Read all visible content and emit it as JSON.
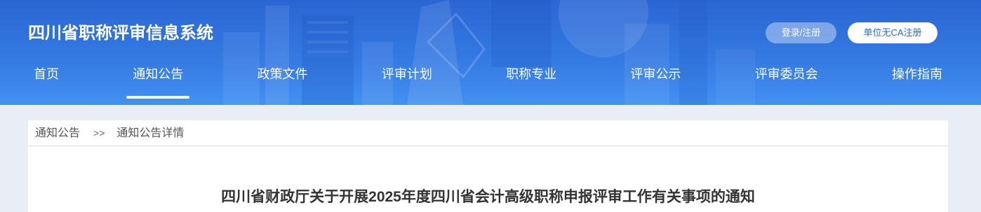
{
  "header": {
    "site_title": "四川省职称评审信息系统",
    "login_label": "登录/注册",
    "ca_register_label": "单位无CA注册"
  },
  "nav": {
    "items": [
      {
        "label": "首页",
        "active": false
      },
      {
        "label": "通知公告",
        "active": true
      },
      {
        "label": "政策文件",
        "active": false
      },
      {
        "label": "评审计划",
        "active": false
      },
      {
        "label": "职称专业",
        "active": false
      },
      {
        "label": "评审公示",
        "active": false
      },
      {
        "label": "评审委员会",
        "active": false
      },
      {
        "label": "操作指南",
        "active": false
      }
    ]
  },
  "breadcrumb": {
    "parent": "通知公告",
    "separator": ">>",
    "current": "通知公告详情"
  },
  "article": {
    "title": "四川省财政厅关于开展2025年度四川省会计高级职称申报评审工作有关事项的通知"
  },
  "colors": {
    "header_top": "#2a66d3",
    "header_bottom": "#4390f2",
    "page_background": "#e9eef4",
    "ca_button_text": "#2a6ad8",
    "text_dark": "#333333"
  }
}
